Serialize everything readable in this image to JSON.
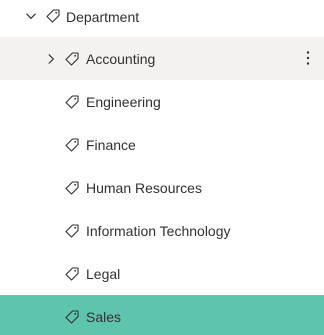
{
  "tree": {
    "root": {
      "label": "Department",
      "expanded": true,
      "icon": "tag-icon"
    },
    "children": [
      {
        "label": "Accounting",
        "expandable": true,
        "state": "hover",
        "has_more_menu": true,
        "icon": "tag-icon"
      },
      {
        "label": "Engineering",
        "icon": "tag-icon"
      },
      {
        "label": "Finance",
        "icon": "tag-icon"
      },
      {
        "label": "Human Resources",
        "icon": "tag-icon"
      },
      {
        "label": "Information Technology",
        "icon": "tag-icon"
      },
      {
        "label": "Legal",
        "icon": "tag-icon"
      },
      {
        "label": "Sales",
        "state": "selected",
        "icon": "tag-icon"
      }
    ]
  },
  "colors": {
    "hover_background": "#f3f2f1",
    "selected_background": "#5fc4ad",
    "text": "#323130"
  }
}
